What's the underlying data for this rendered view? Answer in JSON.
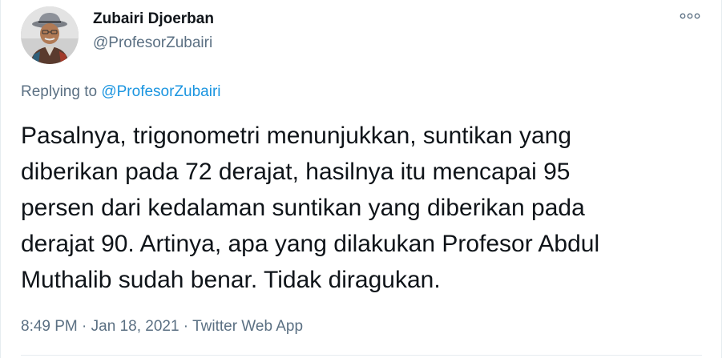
{
  "author": {
    "display_name": "Zubairi Djoerban",
    "handle": "@ProfesorZubairi",
    "avatar_icon": "profile-photo-icon"
  },
  "more_icon": "more-options-icon",
  "reply": {
    "prefix": "Replying to ",
    "mention": "@ProfesorZubairi"
  },
  "tweet": {
    "text": "Pasalnya, trigonometri menunjukkan, suntikan yang\ndiberikan pada 72 derajat, hasilnya itu mencapai 95\npersen dari kedalaman suntikan yang diberikan pada\nderajat 90. Artinya, apa yang dilakukan Profesor Abdul\nMuthalib sudah benar. Tidak diragukan."
  },
  "meta": {
    "time": "8:49 PM",
    "separator": " · ",
    "date": "Jan 18, 2021",
    "source": "Twitter Web App"
  },
  "colors": {
    "text": "#0f1419",
    "secondary": "#5b7083",
    "link": "#1b95e0",
    "border": "#e6ecf0"
  }
}
